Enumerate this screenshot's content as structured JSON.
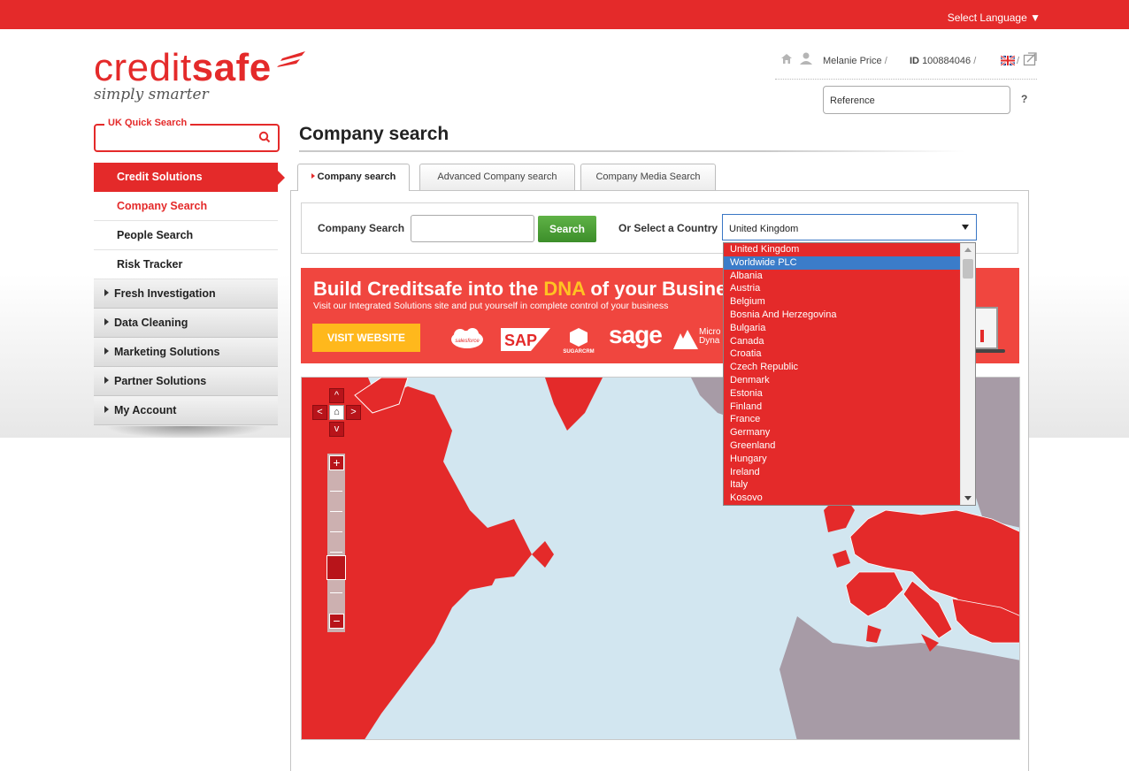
{
  "top_bar": {
    "language_label": "Select Language ▼"
  },
  "logo": {
    "brand_part1": "credit",
    "brand_part2": "safe",
    "tagline": "simply smarter"
  },
  "quick_search": {
    "legend": "UK Quick Search"
  },
  "user": {
    "name": "Melanie Price",
    "sep1": "/",
    "id_label": "ID",
    "id_value": "100884046",
    "sep2": "/",
    "sep3": "/"
  },
  "reference": {
    "placeholder": "Reference"
  },
  "help_label": "?",
  "page_title": "Company search",
  "sidebar": {
    "header": "Credit Solutions",
    "items": [
      {
        "label": "Company Search"
      },
      {
        "label": "People Search"
      },
      {
        "label": "Risk Tracker"
      }
    ],
    "sections": [
      {
        "label": "Fresh Investigation"
      },
      {
        "label": "Data Cleaning"
      },
      {
        "label": "Marketing Solutions"
      },
      {
        "label": "Partner Solutions"
      },
      {
        "label": "My Account"
      }
    ]
  },
  "tabs": [
    {
      "label": "Company search"
    },
    {
      "label": "Advanced Company search"
    },
    {
      "label": "Company Media Search"
    }
  ],
  "search": {
    "company_label": "Company Search",
    "button_label": "Search",
    "country_label": "Or Select a Country",
    "country_selected": "United Kingdom"
  },
  "banner": {
    "headline_before": "Build Creditsafe into the ",
    "headline_dna": "DNA",
    "headline_after": " of your Business",
    "subline": "Visit our Integrated Solutions site and put yourself in complete control of your business",
    "button": "VISIT WEBSITE",
    "partners": [
      "salesforce",
      "SAP",
      "SUGARCRM",
      "sage",
      "Micro",
      "Dyna"
    ]
  },
  "map_controls": {
    "up": "^",
    "down": "v",
    "left": "<",
    "right": ">",
    "home": "⌂",
    "zoom_in": "+",
    "zoom_out": "−"
  },
  "country_dropdown": {
    "highlighted_index": 1,
    "options": [
      "United Kingdom",
      "Worldwide PLC",
      "Albania",
      "Austria",
      "Belgium",
      "Bosnia And Herzegovina",
      "Bulgaria",
      "Canada",
      "Croatia",
      "Czech Republic",
      "Denmark",
      "Estonia",
      "Finland",
      "France",
      "Germany",
      "Greenland",
      "Hungary",
      "Ireland",
      "Italy",
      "Kosovo"
    ]
  },
  "colors": {
    "brand_red": "#e42a2a",
    "banner_red": "#f0463f",
    "search_green": "#4aa036",
    "dropdown_highlight": "#3b7cc9",
    "map_land": "#e42a2a",
    "map_other_land": "#a79ba6",
    "map_water": "#d2e6f0"
  }
}
